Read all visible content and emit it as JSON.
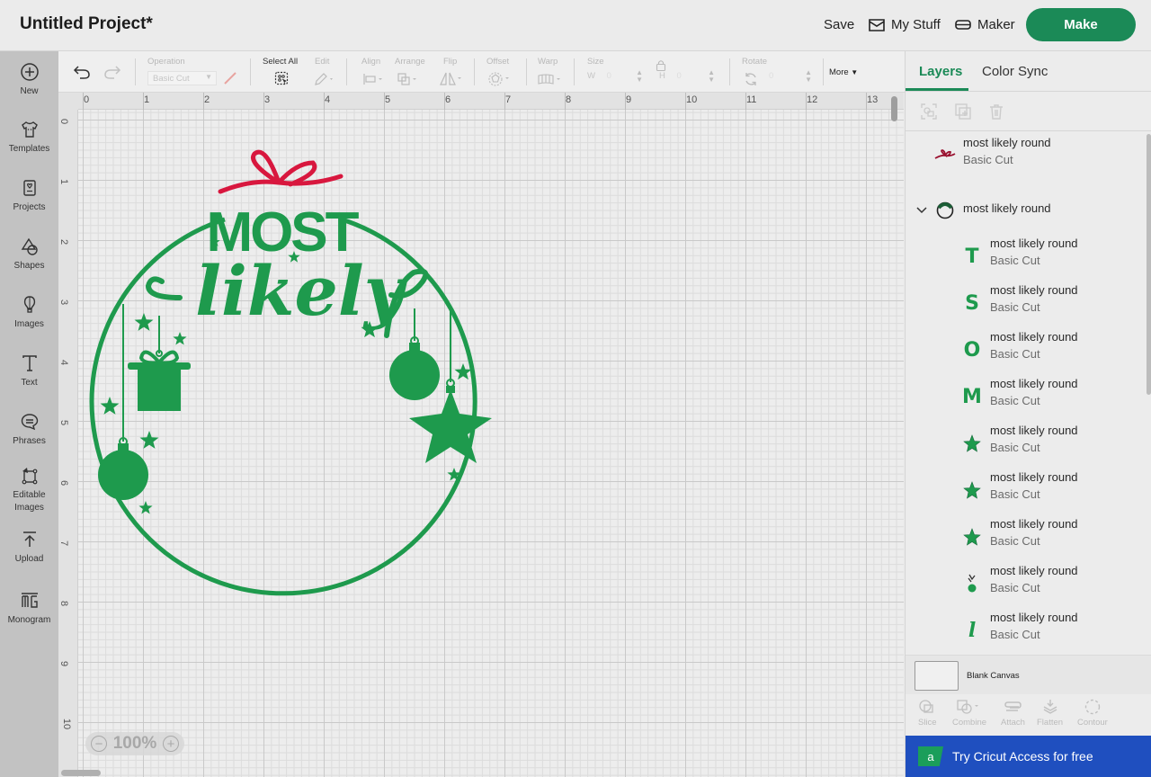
{
  "header": {
    "title": "Untitled Project*",
    "save_label": "Save",
    "mystuff_label": "My Stuff",
    "maker_label": "Maker",
    "make_label": "Make"
  },
  "colors": {
    "brand_green": "#1b8a57",
    "design_green": "#1e9a4d",
    "ribbon_red": "#d8173e",
    "access_blue": "#1f4fbf"
  },
  "leftnav": {
    "items": [
      {
        "label": "New",
        "icon": "plus-circle-icon"
      },
      {
        "label": "Templates",
        "icon": "tshirt-icon"
      },
      {
        "label": "Projects",
        "icon": "project-card-icon"
      },
      {
        "label": "Shapes",
        "icon": "shapes-icon"
      },
      {
        "label": "Images",
        "icon": "hot-air-balloon-icon"
      },
      {
        "label": "Text",
        "icon": "text-icon"
      },
      {
        "label": "Phrases",
        "icon": "speech-bubble-icon"
      },
      {
        "label": "Editable Images",
        "icon": "editable-images-icon"
      },
      {
        "label": "Upload",
        "icon": "upload-icon"
      },
      {
        "label": "Monogram",
        "icon": "monogram-icon"
      }
    ]
  },
  "toolbar": {
    "operation_label": "Operation",
    "operation_value": "Basic Cut",
    "select_all_label": "Select All",
    "edit_label": "Edit",
    "align_label": "Align",
    "arrange_label": "Arrange",
    "flip_label": "Flip",
    "offset_label": "Offset",
    "warp_label": "Warp",
    "size_label": "Size",
    "w_label": "W",
    "w_value": "0",
    "h_label": "H",
    "h_value": "0",
    "rotate_label": "Rotate",
    "rotate_value": "0",
    "more_label": "More"
  },
  "canvas": {
    "ruler_top": [
      "0",
      "1",
      "2",
      "3",
      "4",
      "5",
      "6",
      "7",
      "8",
      "9",
      "10",
      "11",
      "12",
      "13"
    ],
    "ruler_left": [
      "0",
      "1",
      "2",
      "3",
      "4",
      "5",
      "6",
      "7",
      "8",
      "9",
      "10"
    ],
    "zoom_level": "100%",
    "design_words": [
      "MOST",
      "likely"
    ]
  },
  "panel": {
    "tabs": [
      {
        "label": "Layers",
        "active": true
      },
      {
        "label": "Color Sync",
        "active": false
      }
    ],
    "layers": [
      {
        "name": "most likely round",
        "operation": "Basic Cut",
        "thumb": "ribbon",
        "level": 0
      },
      {
        "name": "most likely round",
        "operation": "",
        "thumb": "group-wreath",
        "level": 0,
        "expanded": true
      },
      {
        "name": "most likely round",
        "operation": "Basic Cut",
        "thumb": "T",
        "level": 1
      },
      {
        "name": "most likely round",
        "operation": "Basic Cut",
        "thumb": "S",
        "level": 1
      },
      {
        "name": "most likely round",
        "operation": "Basic Cut",
        "thumb": "O",
        "level": 1
      },
      {
        "name": "most likely round",
        "operation": "Basic Cut",
        "thumb": "M",
        "level": 1
      },
      {
        "name": "most likely round",
        "operation": "Basic Cut",
        "thumb": "star",
        "level": 1
      },
      {
        "name": "most likely round",
        "operation": "Basic Cut",
        "thumb": "star",
        "level": 1
      },
      {
        "name": "most likely round",
        "operation": "Basic Cut",
        "thumb": "star",
        "level": 1
      },
      {
        "name": "most likely round",
        "operation": "Basic Cut",
        "thumb": "ornament",
        "level": 1
      },
      {
        "name": "most likely round",
        "operation": "Basic Cut",
        "thumb": "l",
        "level": 1
      }
    ],
    "blank_canvas_label": "Blank Canvas",
    "bottom_tools": [
      "Slice",
      "Combine",
      "Attach",
      "Flatten",
      "Contour"
    ],
    "access_label": "Try Cricut Access for free",
    "access_logo_letter": "a"
  }
}
